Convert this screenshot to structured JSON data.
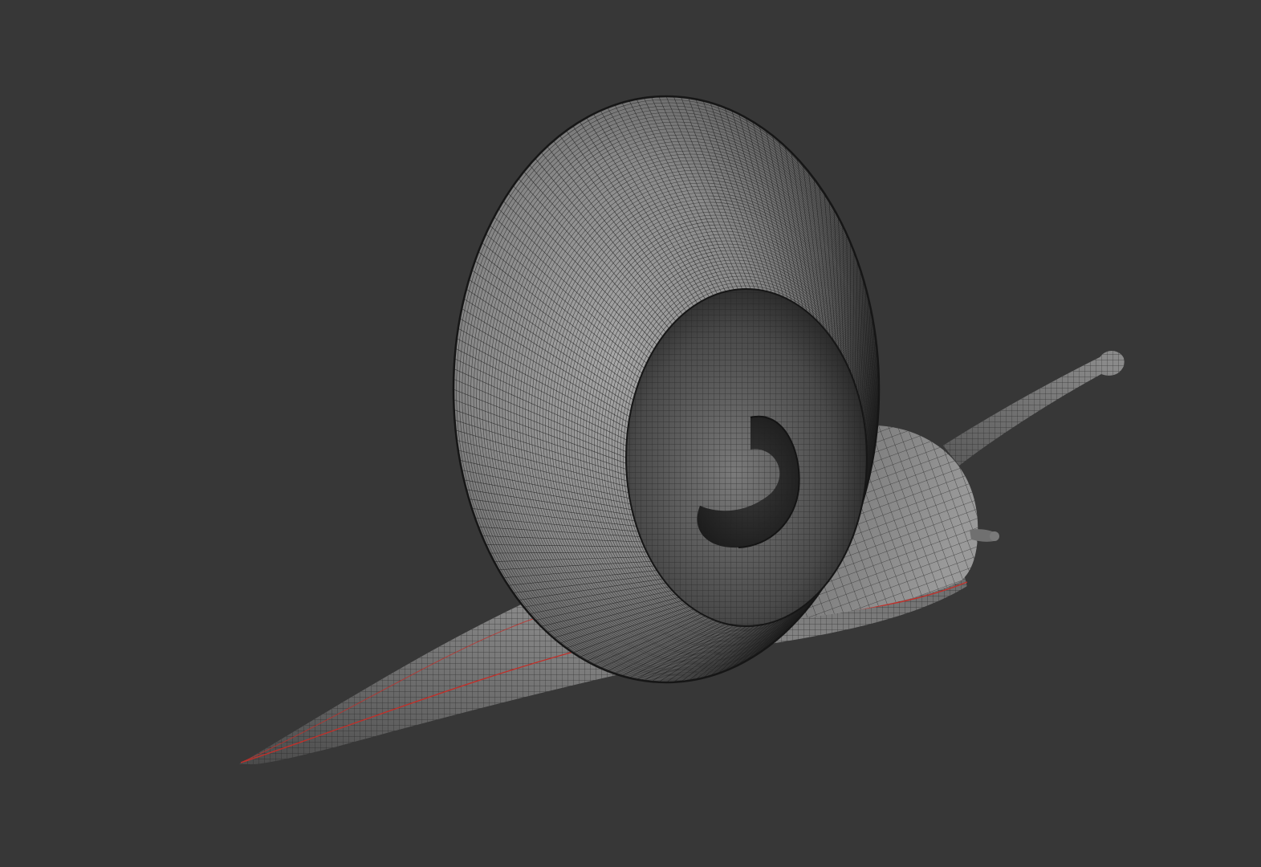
{
  "viewport": {
    "background_color": "#373737",
    "subject": "snail-wireframe-model",
    "mesh_colors": {
      "surface_light": "#9a9a9a",
      "surface_mid": "#6a6a6a",
      "surface_dark": "#2a2a2a",
      "wire": "#1e1e1e",
      "seam": "#c0302a"
    }
  }
}
